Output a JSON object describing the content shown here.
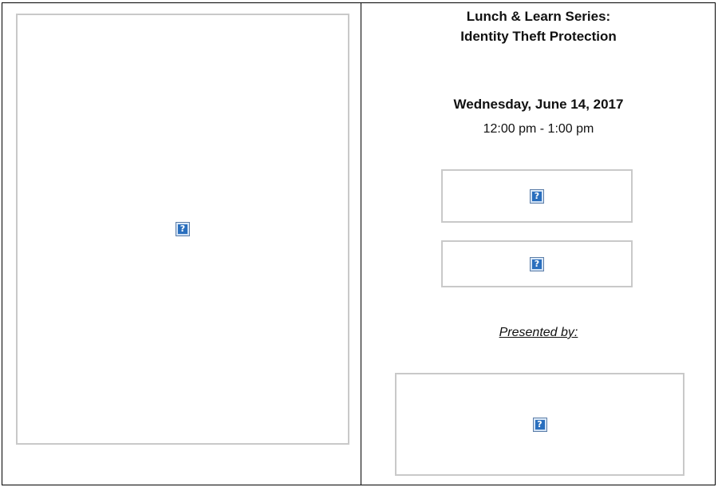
{
  "event": {
    "title_line1": "Lunch & Learn Series:",
    "title_line2": "Identity Theft Protection",
    "date": "Wednesday, June 14, 2017",
    "time": "12:00 pm - 1:00 pm",
    "presented_by_label": "Presented by:"
  },
  "images": {
    "broken_glyph": "?",
    "broken_icon": "broken-image-icon"
  },
  "colors": {
    "placeholder_border": "#c9c9c9",
    "icon_blue": "#2a6fbe"
  }
}
